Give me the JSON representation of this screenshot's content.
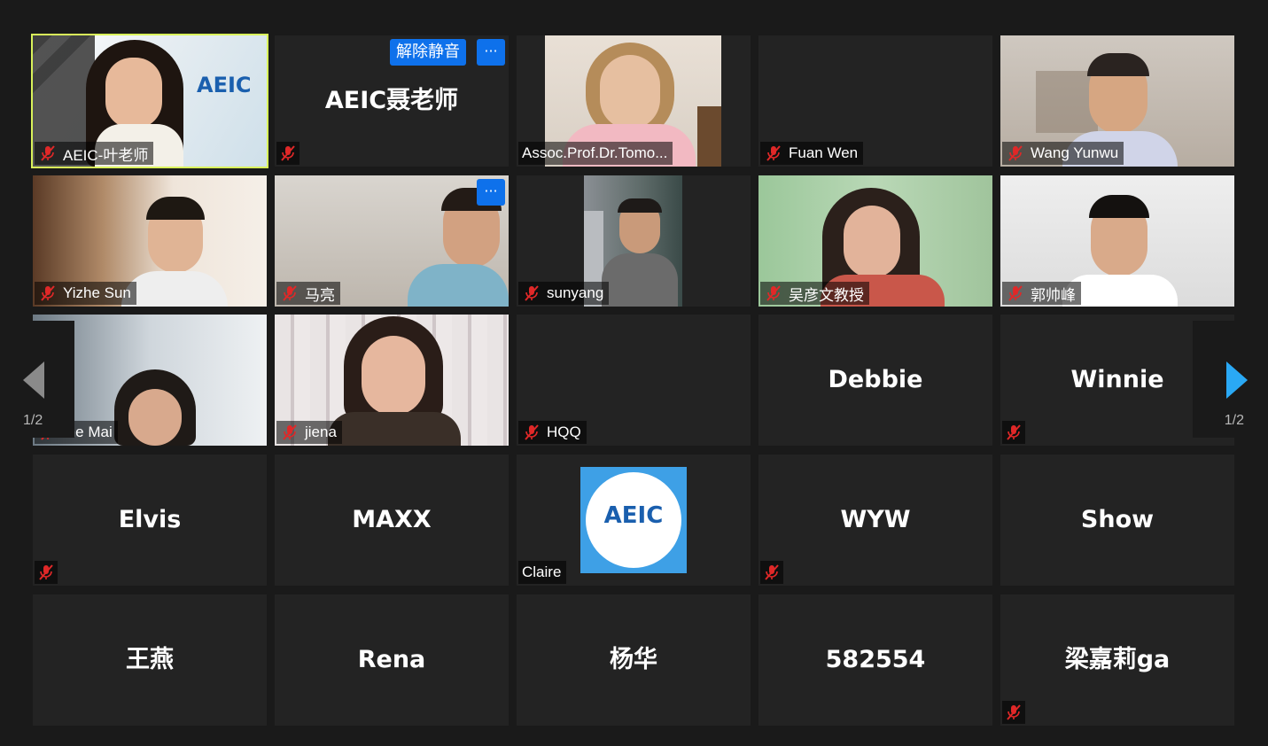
{
  "participants": [
    {
      "name": "AEIC-叶老师",
      "muted": true,
      "video": true,
      "active": true
    },
    {
      "name": "AEIC聂老师",
      "muted": true,
      "video": false,
      "unmute_label": "解除静音",
      "more_label": "···"
    },
    {
      "name": "Assoc.Prof.Dr.Tomo...",
      "muted": false,
      "video": true
    },
    {
      "name": "Fuan Wen",
      "muted": true,
      "video": false
    },
    {
      "name": "Wang Yunwu",
      "muted": true,
      "video": true
    },
    {
      "name": "Yizhe Sun",
      "muted": true,
      "video": true
    },
    {
      "name": "马亮",
      "muted": true,
      "video": true,
      "more_label": "···"
    },
    {
      "name": "sunyang",
      "muted": true,
      "video": true
    },
    {
      "name": "吴彦文教授",
      "muted": true,
      "video": true
    },
    {
      "name": "郭帅峰",
      "muted": true,
      "video": true
    },
    {
      "name": "ıne Mai",
      "muted": true,
      "video": true
    },
    {
      "name": "jiena",
      "muted": true,
      "video": true
    },
    {
      "name": "HQQ",
      "muted": true,
      "video": false
    },
    {
      "name": "Debbie",
      "muted": false,
      "video": false
    },
    {
      "name": "Winnie",
      "muted": true,
      "video": false
    },
    {
      "name": "Elvis",
      "muted": true,
      "video": false
    },
    {
      "name": "MAXX",
      "muted": false,
      "video": false
    },
    {
      "name": "Claire",
      "muted": false,
      "video": false,
      "avatar_logo": "AEIC"
    },
    {
      "name": "WYW",
      "muted": true,
      "video": false
    },
    {
      "name": "Show",
      "muted": false,
      "video": false
    },
    {
      "name": "王燕",
      "muted": false,
      "video": false
    },
    {
      "name": "Rena",
      "muted": false,
      "video": false
    },
    {
      "name": "杨华",
      "muted": false,
      "video": false
    },
    {
      "name": "582554",
      "muted": false,
      "video": false
    },
    {
      "name": "梁嘉莉ga",
      "muted": true,
      "video": false
    }
  ],
  "pagination": {
    "prev_label": "1/2",
    "next_label": "1/2"
  },
  "icons": {
    "mute": "microphone-muted-icon",
    "prev": "chevron-left-icon",
    "next": "chevron-right-icon"
  },
  "colors": {
    "active_speaker_border": "#d9f25a",
    "button_blue": "#0e71eb",
    "mute_red": "#e02828",
    "next_arrow": "#2aa9f5",
    "prev_arrow": "#8a8a8a"
  }
}
